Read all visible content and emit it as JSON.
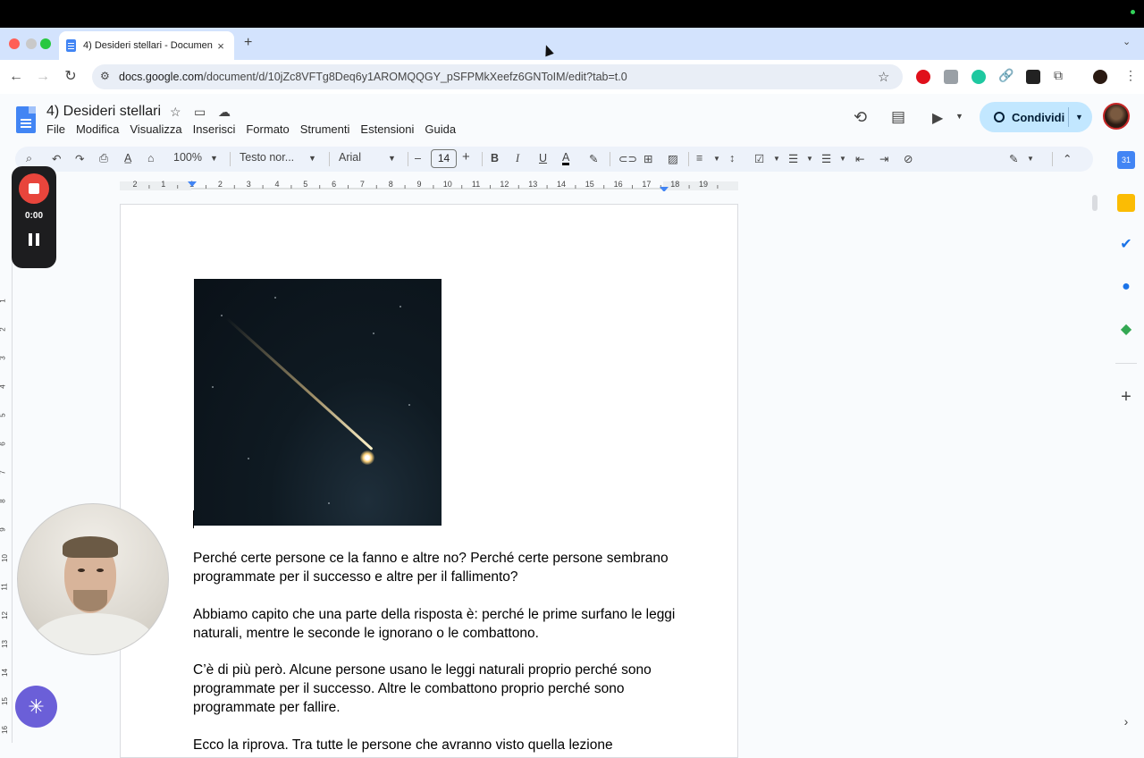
{
  "browser": {
    "tab_title": "4) Desideri stellari - Documen",
    "tab_close": "×",
    "new_tab": "+",
    "url_host": "docs.google.com",
    "url_path": "/document/d/10jZc8VFTg8Deq6y1AROMQQGY_pSFPMkXeefz6GNToIM/edit?tab=t.0"
  },
  "docs": {
    "title": "4) Desideri stellari",
    "menu": [
      "File",
      "Modifica",
      "Visualizza",
      "Inserisci",
      "Formato",
      "Strumenti",
      "Estensioni",
      "Guida"
    ],
    "share_label": "Condividi"
  },
  "toolbar": {
    "zoom": "100%",
    "style": "Testo nor...",
    "font": "Arial",
    "font_size": "14",
    "minus": "–",
    "plus": "+",
    "bold": "B",
    "italic": "I",
    "underline": "U",
    "text_color": "A"
  },
  "ruler": {
    "ticks": [
      "2",
      "1",
      "1",
      "2",
      "3",
      "4",
      "5",
      "6",
      "7",
      "8",
      "9",
      "10",
      "11",
      "12",
      "13",
      "14",
      "15",
      "16",
      "17",
      "18",
      "19"
    ]
  },
  "left_ruler": {
    "ticks": [
      "1",
      "2",
      "3",
      "4",
      "5",
      "6",
      "7",
      "8",
      "9",
      "10",
      "11",
      "12",
      "13",
      "14",
      "15",
      "16"
    ]
  },
  "document": {
    "paragraphs": [
      "Perché certe persone ce la fanno e altre no? Perché certe persone sembrano programmate per il successo e altre per il fallimento?",
      "Abbiamo capito che una parte della risposta è: perché le prime surfano le leggi naturali, mentre le seconde le ignorano o le combattono.",
      "C’è di più però. Alcune persone usano le leggi naturali proprio perché sono programmate per il successo. Altre le combattono proprio perché sono programmate per fallire.",
      "Ecco la riprova. Tra tutte le persone che avranno visto quella lezione"
    ]
  },
  "recorder": {
    "time": "0:00"
  },
  "icons": {
    "accent": "#4285f4",
    "share_bg": "#c2e7ff",
    "record_red": "#e8453c"
  }
}
